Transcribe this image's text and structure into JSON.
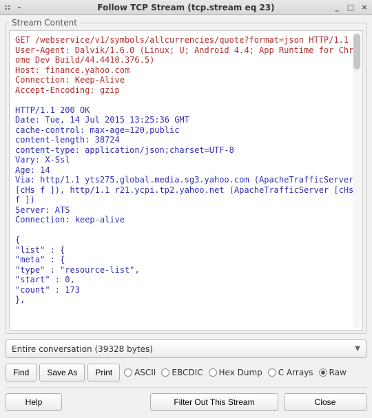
{
  "titlebar": {
    "title": "Follow TCP Stream (tcp.stream eq 23)",
    "icons": {
      "min": "_",
      "max": "□",
      "close": "×"
    }
  },
  "fieldset_label": "Stream Content",
  "stream": {
    "request": "GET /webservice/v1/symbols/allcurrencies/quote?format=json HTTP/1.1\nUser-Agent: Dalvik/1.6.0 (Linux; U; Android 4.4; App Runtime for Chrome Dev Build/44.4410.376.5)\nHost: finance.yahoo.com\nConnection: Keep-Alive\nAccept-Encoding: gzip",
    "response": "HTTP/1.1 200 OK\nDate: Tue, 14 Jul 2015 13:25:36 GMT\ncache-control: max-age=120,public\ncontent-length: 38724\ncontent-type: application/json;charset=UTF-8\nVary: X-Ssl\nAge: 14\nVia: http/1.1 yts275.global.media.sg3.yahoo.com (ApacheTrafficServer [cHs f ]), http/1.1 r21.ycpi.tp2.yahoo.net (ApacheTrafficServer [cHs f ])\nServer: ATS\nConnection: keep-alive\n\n{\n\"list\" : {\n\"meta\" : {\n\"type\" : \"resource-list\",\n\"start\" : 0,\n\"count\" : 173\n},"
  },
  "combo": {
    "label": "Entire conversation (39328 bytes)"
  },
  "actions": {
    "find": "Find",
    "save_as": "Save As",
    "print": "Print"
  },
  "formats": {
    "options": [
      "ASCII",
      "EBCDIC",
      "Hex Dump",
      "C Arrays",
      "Raw"
    ],
    "selected": "Raw"
  },
  "footer": {
    "help": "Help",
    "filter_out": "Filter Out This Stream",
    "close": "Close"
  }
}
